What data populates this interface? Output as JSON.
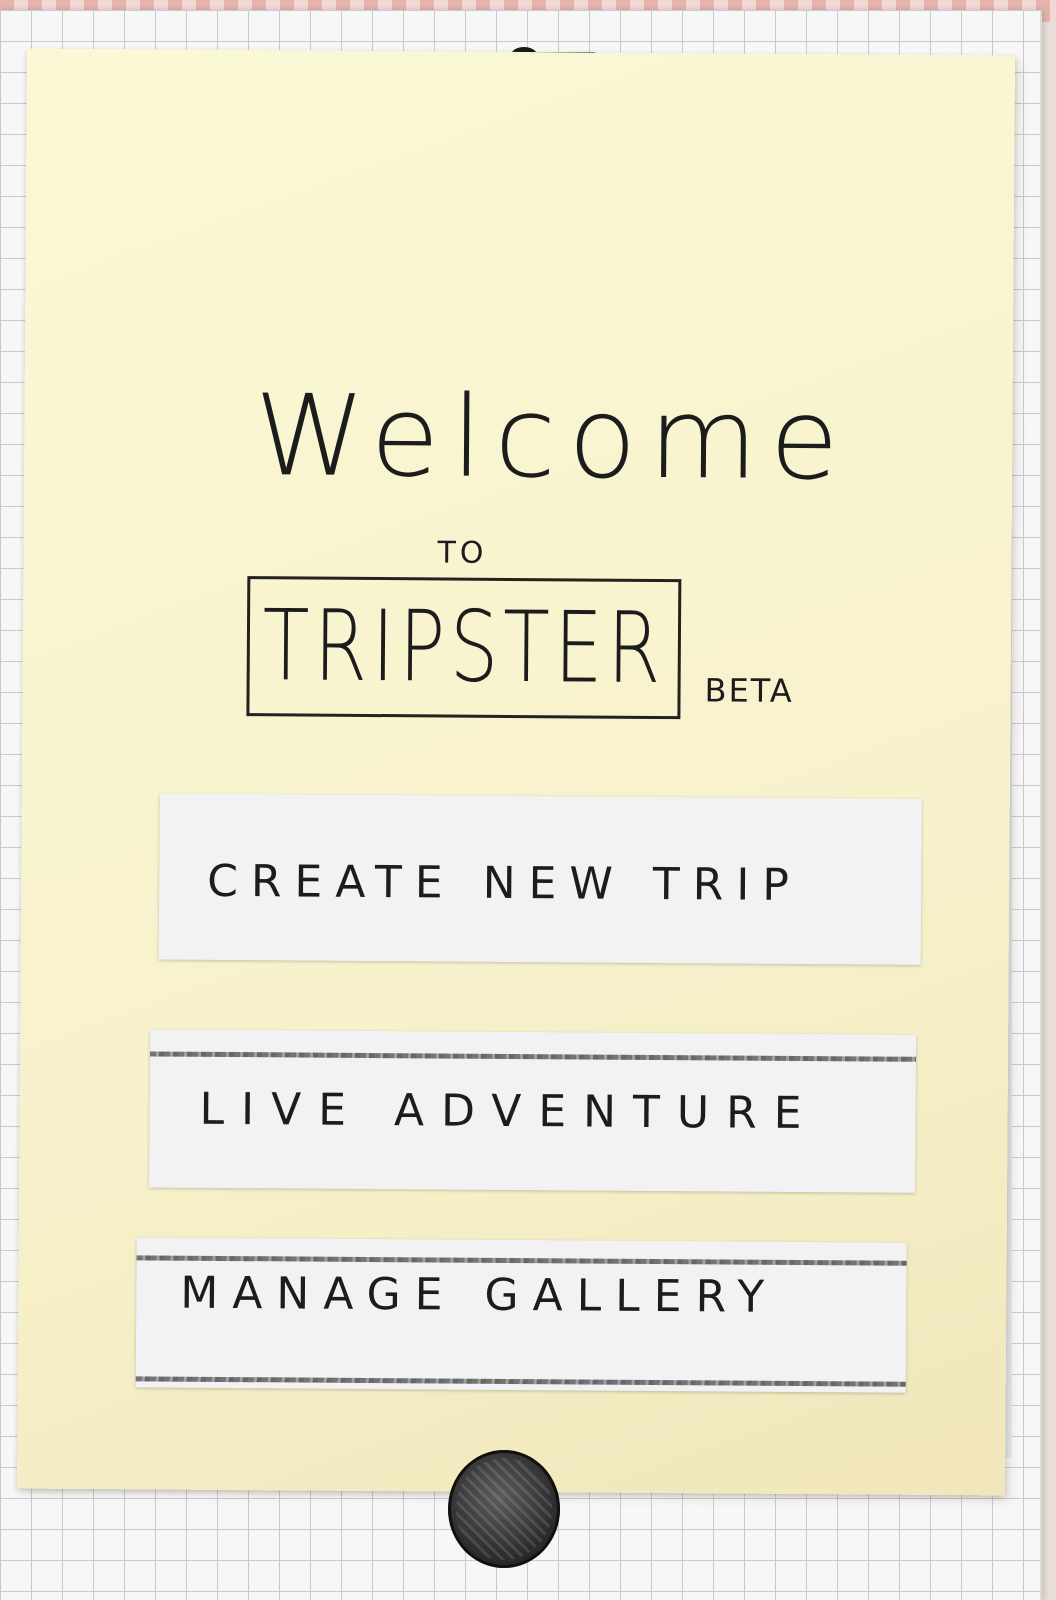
{
  "welcome_screen": {
    "heading": "Welcome",
    "connector": "TO",
    "app_name": "TRIPSTER",
    "badge": "BETA"
  },
  "menu": {
    "create_label": "CREATE NEW TRIP",
    "live_label": "LIVE ADVENTURE",
    "gallery_label": "MANAGE GALLERY"
  },
  "device": {
    "speaker_icon": "speaker-icon",
    "home_icon": "home-button-icon"
  },
  "colors": {
    "screen_paper": "#fbf8d6",
    "button_paper": "#f2f2f5",
    "ink": "#1c1c1c"
  }
}
